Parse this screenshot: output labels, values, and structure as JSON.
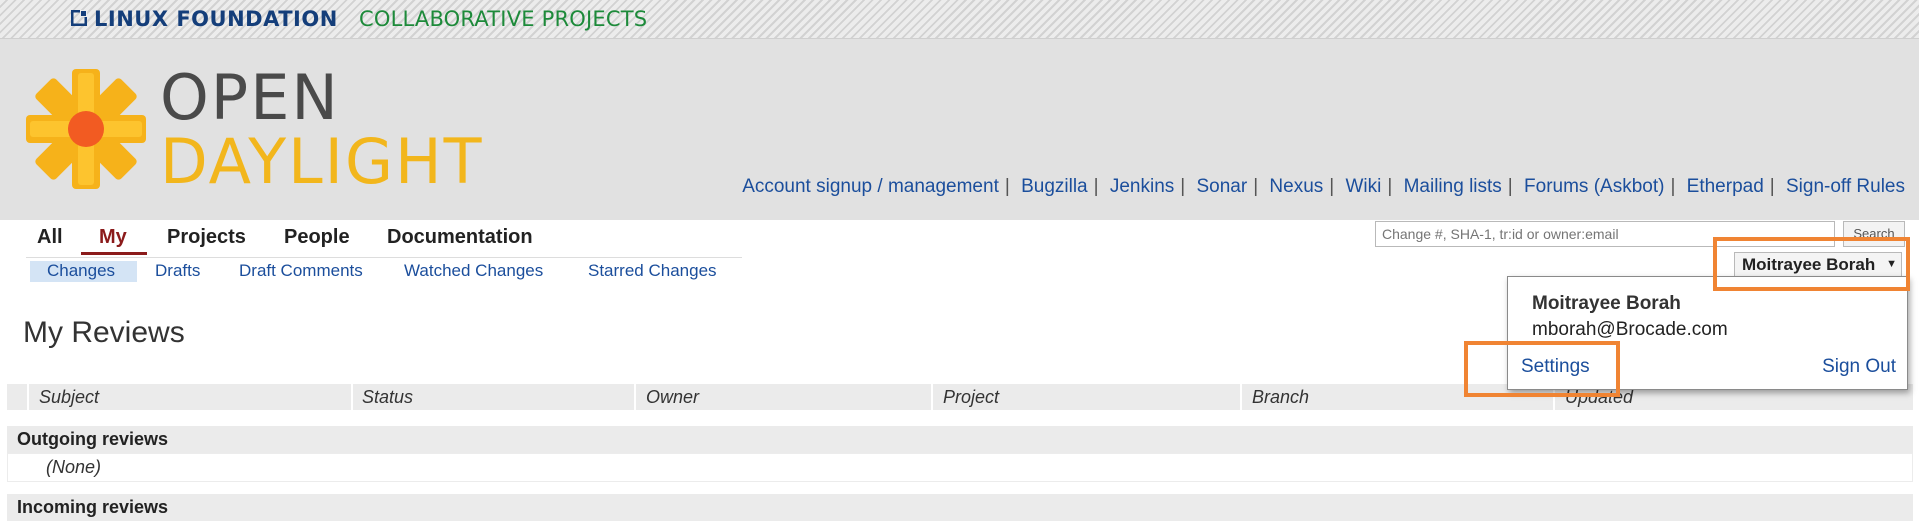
{
  "banner": {
    "org_name": "LINUX FOUNDATION",
    "org_sub": "COLLABORATIVE PROJECTS"
  },
  "logo": {
    "line1": "OPEN",
    "line2": "DAYLIGHT",
    "colors": {
      "petals": "#f6b21a",
      "center": "#f25b22",
      "open_text": "#4a4a4a",
      "daylight_text": "#f2b61c"
    }
  },
  "external_links": [
    "Account signup / management",
    "Bugzilla",
    "Jenkins",
    "Sonar",
    "Nexus",
    "Wiki",
    "Mailing lists",
    "Forums (Askbot)",
    "Etherpad",
    "Sign-off Rules"
  ],
  "top_nav": {
    "items": [
      "All",
      "My",
      "Projects",
      "People",
      "Documentation"
    ],
    "active": "My"
  },
  "sub_nav": {
    "items": [
      "Changes",
      "Drafts",
      "Draft Comments",
      "Watched Changes",
      "Starred Changes"
    ],
    "active": "Changes"
  },
  "search": {
    "placeholder": "Change #, SHA-1, tr:id or owner:email",
    "button_label": "Search"
  },
  "user_menu": {
    "button_label": "Moitrayee Borah",
    "name": "Moitrayee Borah",
    "email": "mborah@Brocade.com",
    "settings_label": "Settings",
    "signout_label": "Sign Out"
  },
  "page_title": "My Reviews",
  "table": {
    "columns": [
      "Subject",
      "Status",
      "Owner",
      "Project",
      "Branch",
      "Updated"
    ],
    "sections": [
      {
        "title": "Outgoing reviews",
        "empty_text": "(None)"
      },
      {
        "title": "Incoming reviews"
      }
    ]
  },
  "colors": {
    "link": "#1b4e9c",
    "active_tab": "#8b1b1b",
    "highlight": "#f08433"
  }
}
